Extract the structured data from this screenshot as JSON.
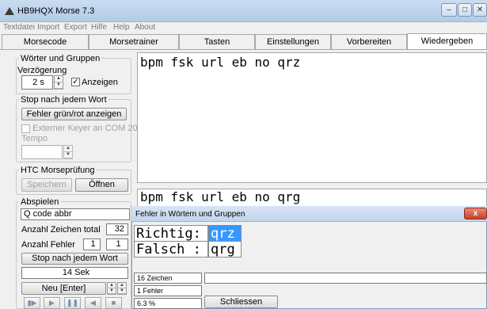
{
  "window": {
    "title": "HB9HQX Morse 7.3",
    "minimize": "–",
    "maximize": "□",
    "close": "✕"
  },
  "menu": [
    "Textdatei",
    "Import",
    "Export",
    "Hilfe",
    "Help",
    "About"
  ],
  "tabs": [
    "Morsecode",
    "Morsetrainer",
    "Tasten",
    "Einstellungen",
    "Vorbereiten",
    "Wiedergeben"
  ],
  "left": {
    "group1": {
      "label": "Wörter und Gruppen",
      "delay_label": "Verzögerung",
      "delay_value": "2 s",
      "show_label": "Anzeigen",
      "show_checked": "✓"
    },
    "group2": {
      "label": "Stop nach jedem Wort",
      "errors_button": "Fehler grün/rot anzeigen",
      "ext_keyer": "Externer Keyer an COM 20",
      "tempo": "Tempo"
    },
    "group3": {
      "label": "HTC Morseprüfung",
      "save_button": "Speichern",
      "open_button": "Öffnen"
    },
    "group4": {
      "label": "Abspielen",
      "mode_value": "Q code abbr",
      "chars_total_label": "Anzahl Zeichen total",
      "chars_total_value": "32",
      "errors_label": "Anzahl Fehler",
      "errors_value_a": "1",
      "errors_value_b": "1",
      "stop_button": "Stop nach jedem Wort",
      "time_value": "14 Sek",
      "new_button": "Neu  [Enter]"
    }
  },
  "main": {
    "text_top": "bpm fsk url eb no qrz",
    "text_bottom": "bpm fsk url eb no qrg"
  },
  "dialog": {
    "title": "Fehler in Wörtern und Gruppen",
    "close": "x",
    "correct_label": "Richtig:",
    "correct_value": "qrz",
    "wrong_label": "Falsch :",
    "wrong_value": "qrg",
    "chars": "16 Zeichen",
    "errors": "1 Fehler",
    "percent": "6.3 %",
    "close_button": "Schliessen"
  },
  "player": [
    "▮▶",
    "▶",
    "❚❚",
    "◀",
    "■"
  ]
}
